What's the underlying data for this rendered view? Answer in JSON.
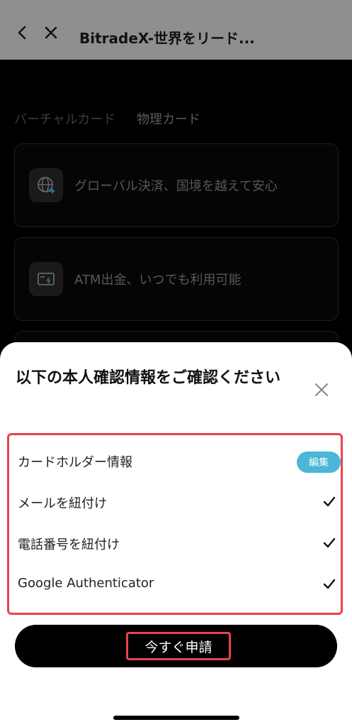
{
  "header": {
    "title": "BitradeX-世界をリード..."
  },
  "tabs": [
    {
      "label": "バーチャルカード"
    },
    {
      "label": "物理カード"
    }
  ],
  "cards": [
    {
      "icon": "globe-transfer-icon",
      "label": "グローバル決済、国境を越えて安心"
    },
    {
      "icon": "atm-card-icon",
      "label": "ATM出金、いつでも利用可能"
    }
  ],
  "sheet": {
    "title": "以下の本人確認情報をご確認ください",
    "items": [
      {
        "label": "カードホルダー情報",
        "action": "編集"
      },
      {
        "label": "メールを紐付け",
        "status": "check-icon"
      },
      {
        "label": "電話番号を紐付け",
        "status": "check-icon"
      },
      {
        "label": "Google Authenticator",
        "status": "check-icon"
      }
    ],
    "apply_label": "今すぐ申請"
  },
  "colors": {
    "highlight": "#e9434e",
    "edit_button": "#4bb6d6",
    "overlay_header": "#8f8f8f"
  }
}
